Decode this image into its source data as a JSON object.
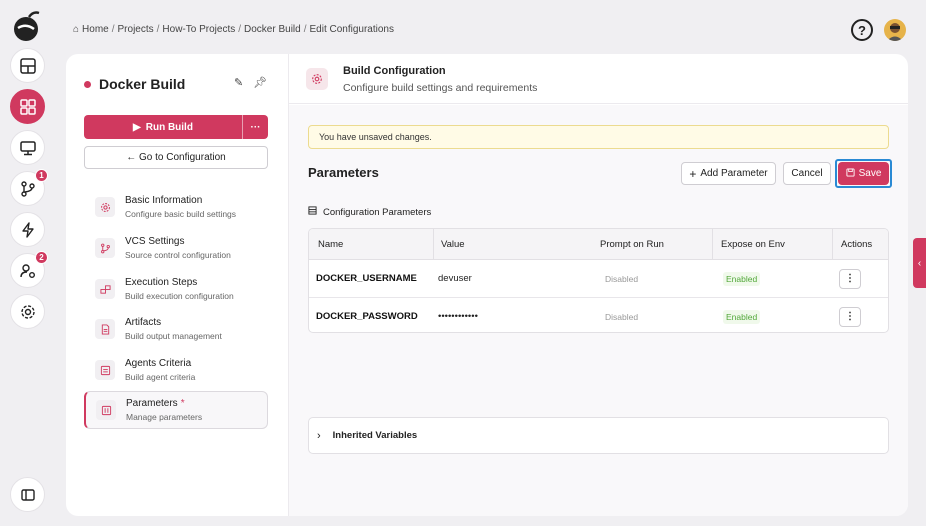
{
  "breadcrumb": [
    "Home",
    "Projects",
    "How-To Projects",
    "Docker Build",
    "Edit Configurations"
  ],
  "rail": {
    "badges": {
      "vcs": "1",
      "agents": "2"
    },
    "accent": "#d0395f"
  },
  "sidebar": {
    "title": "Docker Build",
    "run_label": "Run Build",
    "more_label": "···",
    "goto_label": "← Go to Configuration",
    "items": [
      {
        "label": "Basic Information",
        "sub": "Configure basic build settings",
        "icon": "gear-icon"
      },
      {
        "label": "VCS Settings",
        "sub": "Source control configuration",
        "icon": "branch-icon"
      },
      {
        "label": "Execution Steps",
        "sub": "Build execution configuration",
        "icon": "steps-icon"
      },
      {
        "label": "Artifacts",
        "sub": "Build output management",
        "icon": "file-icon"
      },
      {
        "label": "Agents Criteria",
        "sub": "Build agent criteria",
        "icon": "agent-icon"
      },
      {
        "label": "Parameters",
        "required": "*",
        "sub": "Manage parameters",
        "icon": "params-icon"
      }
    ]
  },
  "header": {
    "title": "Build Configuration",
    "subtitle": "Configure build settings and requirements"
  },
  "main": {
    "warning": "You have unsaved changes.",
    "title": "Parameters",
    "add_label": "Add Parameter",
    "cancel_label": "Cancel",
    "save_label": "Save",
    "section_label": "Configuration Parameters",
    "columns": [
      "Name",
      "Value",
      "Prompt on Run",
      "Expose on Env",
      "Actions"
    ],
    "rows": [
      {
        "name": "DOCKER_USERNAME",
        "value": "devuser",
        "prompt": "Disabled",
        "expose": "Enabled",
        "action": "⋮"
      },
      {
        "name": "DOCKER_PASSWORD",
        "value": "••••••••••••",
        "prompt": "Disabled",
        "expose": "Enabled",
        "action": "⋮"
      }
    ],
    "inherited_label": "Inherited Variables"
  }
}
